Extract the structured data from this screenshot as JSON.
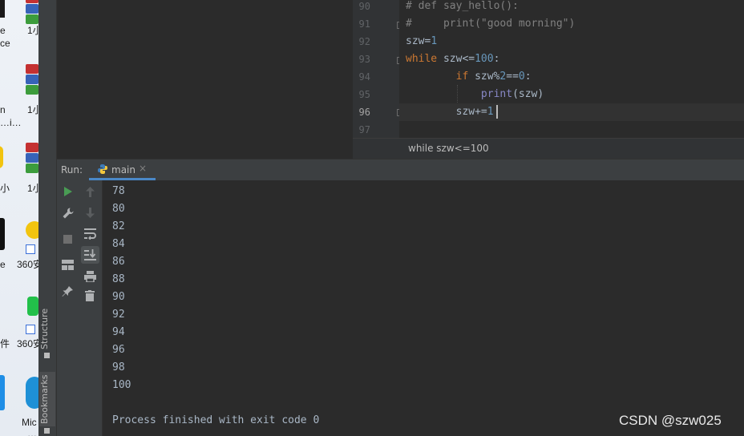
{
  "desktop": {
    "labels": [
      "e",
      "ce",
      "1小",
      "n",
      "…i…",
      "1小",
      "小",
      "1小",
      "e",
      "360安",
      "件",
      "360安",
      "Mic",
      "…"
    ]
  },
  "side_tabs": {
    "structure": "Structure",
    "bookmarks": "Bookmarks"
  },
  "editor": {
    "line_numbers": [
      "90",
      "91",
      "92",
      "93",
      "94",
      "95",
      "96",
      "97"
    ],
    "current_line": "96",
    "code_lines": [
      {
        "text": "# def say_hello():",
        "kind": "comment"
      },
      {
        "text": "#     print(\"good morning\")",
        "kind": "comment"
      },
      {
        "text": "szw=1",
        "kind": "code"
      },
      {
        "text": "while szw<=100:",
        "kind": "code"
      },
      {
        "text": "        if szw%2==0:",
        "kind": "code"
      },
      {
        "text": "            print(szw)",
        "kind": "code"
      },
      {
        "text": "        szw+=1",
        "kind": "code"
      },
      {
        "text": "",
        "kind": "code"
      }
    ],
    "breadcrumb": "while szw<=100"
  },
  "run_panel": {
    "label": "Run:",
    "tab_name": "main",
    "close_glyph": "×",
    "output_lines": [
      "78",
      "80",
      "82",
      "84",
      "86",
      "88",
      "90",
      "92",
      "94",
      "96",
      "98",
      "100"
    ],
    "finish_message": "Process finished with exit code 0"
  },
  "watermark": "CSDN @szw025",
  "colors": {
    "keyword": "#cc7832",
    "number": "#6897bb",
    "comment": "#808080",
    "builtin": "#8888c6",
    "run_green": "#499c54",
    "tab_underline": "#4a88c7"
  }
}
